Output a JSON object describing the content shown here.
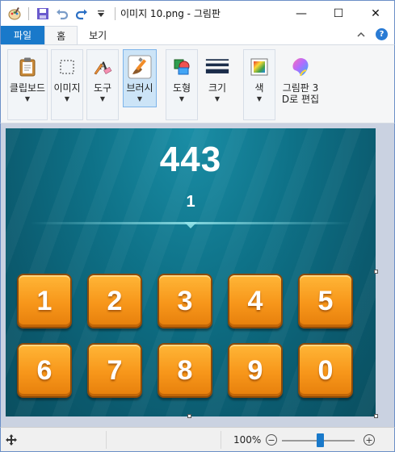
{
  "window": {
    "title": "이미지 10.png - 그림판",
    "minimize": "—",
    "maximize": "☐",
    "close": "✕"
  },
  "quick_access": {
    "icons": [
      "paint-app-icon",
      "save-icon",
      "undo-icon",
      "redo-icon",
      "customize-quick-access-icon"
    ]
  },
  "tabs": [
    {
      "label": "파일"
    },
    {
      "label": "홈"
    },
    {
      "label": "보기"
    }
  ],
  "ribbon_groups": [
    {
      "label": "클립보드",
      "icon": "clipboard-icon"
    },
    {
      "label": "이미지",
      "icon": "select-icon"
    },
    {
      "label": "도구",
      "icon": "tools-icon"
    },
    {
      "label": "브러시",
      "icon": "brush-icon"
    },
    {
      "label": "도형",
      "icon": "shapes-icon"
    },
    {
      "label": "크기",
      "icon": "size-icon"
    },
    {
      "label": "색",
      "icon": "color-icon"
    },
    {
      "label_line1": "그림판 3",
      "label_line2": "D로 편집",
      "icon": "paint3d-icon"
    }
  ],
  "canvas": {
    "score": "443",
    "subscore": "1",
    "keys": [
      "1",
      "2",
      "3",
      "4",
      "5",
      "6",
      "7",
      "8",
      "9",
      "0"
    ]
  },
  "status": {
    "zoom": "100%",
    "zoom_level": 0.52
  },
  "colors": {
    "accent": "#1979ca",
    "key_orange": "#f7961a",
    "canvas_teal": "#0e7187"
  }
}
